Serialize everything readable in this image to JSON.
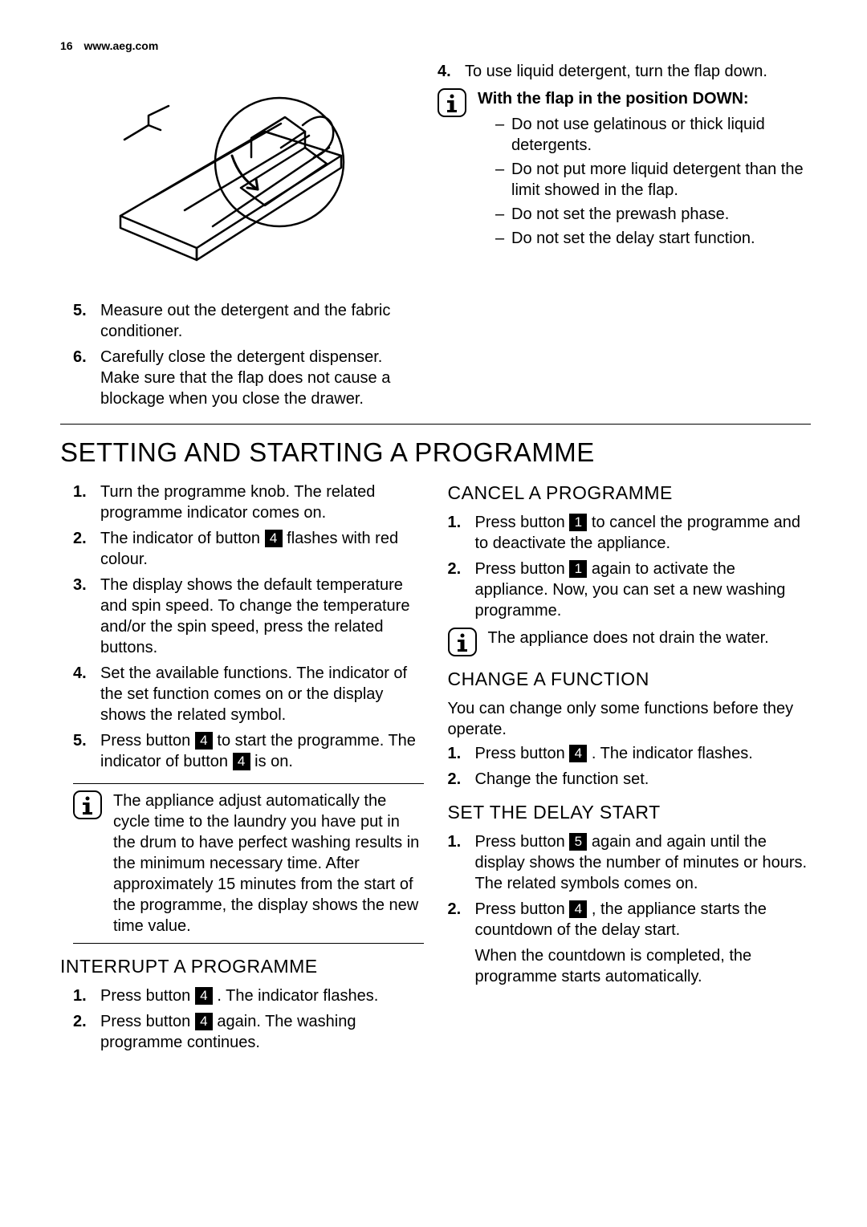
{
  "header": {
    "page_number": "16",
    "site": "www.aeg.com"
  },
  "top_right": {
    "step4_num": "4.",
    "step4_text": "To use liquid detergent, turn the flap down.",
    "info_lead_bold": "With the flap in the position DOWN:",
    "info_items": [
      "Do not use gelatinous or thick liquid detergents.",
      "Do not put more liquid detergent than the limit showed in the flap.",
      "Do not set the prewash phase.",
      "Do not set the delay start function."
    ]
  },
  "top_left_steps": {
    "s5_num": "5.",
    "s5_text": "Measure out the detergent and the fabric conditioner.",
    "s6_num": "6.",
    "s6_text": "Carefully close the detergent dispenser. Make sure that the flap does not cause a blockage when you close the drawer."
  },
  "section_title": "SETTING AND STARTING A PROGRAMME",
  "left_col": {
    "steps": {
      "s1_num": "1.",
      "s1_text": "Turn the programme knob. The related programme indicator comes on.",
      "s2_num": "2.",
      "s2_a": "The indicator of button ",
      "s2_btn": "4",
      "s2_b": " flashes with red colour.",
      "s3_num": "3.",
      "s3_text": "The display shows the default temperature and spin speed. To change the temperature and/or the spin speed, press the related buttons.",
      "s4_num": "4.",
      "s4_text": "Set the available functions. The indicator of the set function comes on or the display shows the related symbol.",
      "s5_num": "5.",
      "s5_a": "Press button ",
      "s5_btn1": "4",
      "s5_b": " to start the programme. The indicator of button ",
      "s5_btn2": "4",
      "s5_c": " is on."
    },
    "info": "The appliance adjust automatically the cycle time to the laundry you have put in the drum to have perfect washing results in the minimum necessary time. After approximately 15 minutes from the start of the programme, the display shows the new time value.",
    "interrupt_title": "INTERRUPT A PROGRAMME",
    "interrupt": {
      "s1_num": "1.",
      "s1_a": "Press button ",
      "s1_btn": "4",
      "s1_b": " . The indicator flashes.",
      "s2_num": "2.",
      "s2_a": "Press button ",
      "s2_btn": "4",
      "s2_b": " again. The washing programme continues."
    }
  },
  "right_col": {
    "cancel_title": "CANCEL A PROGRAMME",
    "cancel": {
      "s1_num": "1.",
      "s1_a": "Press button ",
      "s1_btn": "1",
      "s1_b": " to cancel the programme and to deactivate the appliance.",
      "s2_num": "2.",
      "s2_a": "Press button ",
      "s2_btn": "1",
      "s2_b": " again to activate the appliance. Now, you can set a new washing programme."
    },
    "cancel_info": "The appliance does not drain the water.",
    "change_title": "CHANGE A FUNCTION",
    "change_intro": "You can change only some functions before they operate.",
    "change": {
      "s1_num": "1.",
      "s1_a": "Press button ",
      "s1_btn": "4",
      "s1_b": " . The indicator flashes.",
      "s2_num": "2.",
      "s2_text": "Change the function set."
    },
    "delay_title": "SET THE DELAY START",
    "delay": {
      "s1_num": "1.",
      "s1_a": "Press button ",
      "s1_btn": "5",
      "s1_b": " again and again until the display shows the number of minutes or hours. The related symbols comes on.",
      "s2_num": "2.",
      "s2_a": "Press button ",
      "s2_btn": "4",
      "s2_b": " , the appliance starts the countdown of the delay start.",
      "s2_c": "When the countdown is completed, the programme starts automatically."
    }
  }
}
